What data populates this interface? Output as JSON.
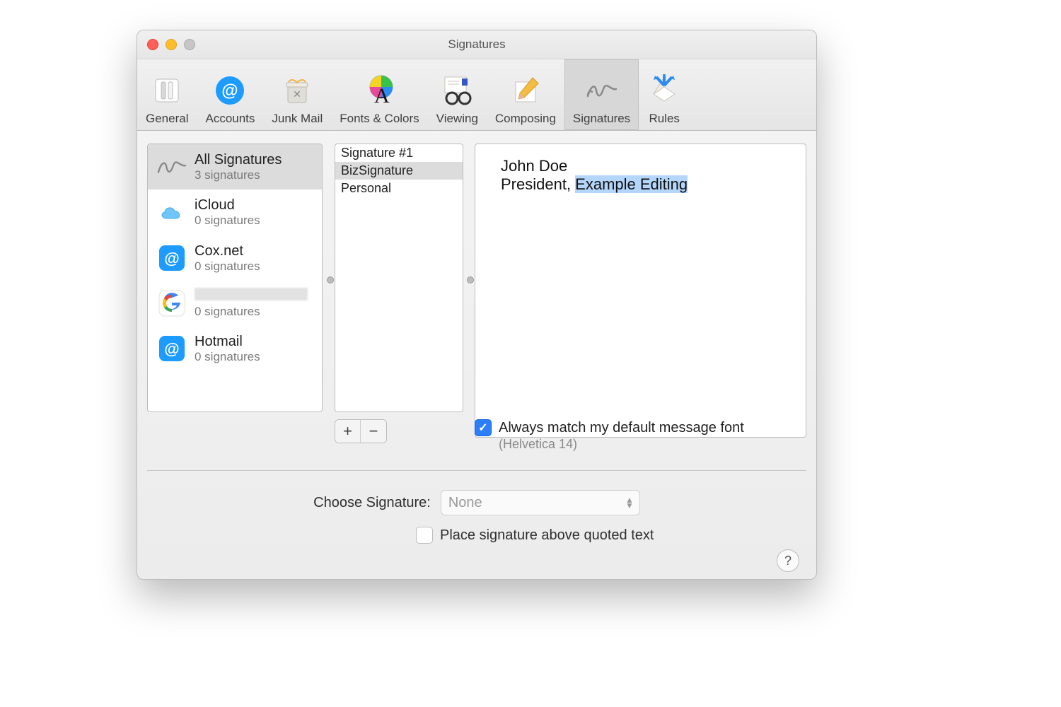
{
  "window": {
    "title": "Signatures"
  },
  "toolbar": {
    "items": [
      {
        "label": "General"
      },
      {
        "label": "Accounts"
      },
      {
        "label": "Junk Mail"
      },
      {
        "label": "Fonts & Colors"
      },
      {
        "label": "Viewing"
      },
      {
        "label": "Composing"
      },
      {
        "label": "Signatures"
      },
      {
        "label": "Rules"
      }
    ]
  },
  "accounts": [
    {
      "title": "All Signatures",
      "subtitle": "3 signatures",
      "selected": true
    },
    {
      "title": "iCloud",
      "subtitle": "0 signatures"
    },
    {
      "title": "Cox.net",
      "subtitle": "0 signatures"
    },
    {
      "title": "",
      "subtitle": "0 signatures",
      "redacted": true
    },
    {
      "title": "Hotmail",
      "subtitle": "0 signatures"
    }
  ],
  "signatures": [
    {
      "name": "Signature #1"
    },
    {
      "name": "BizSignature",
      "selected": true
    },
    {
      "name": "Personal"
    }
  ],
  "editor": {
    "line1": "John Doe",
    "line2_prefix": "President, ",
    "line2_selected": "Example Editing"
  },
  "options": {
    "always_match_label": "Always match my default message font",
    "always_match_sub": "(Helvetica 14)",
    "always_match_checked": true,
    "choose_label": "Choose Signature:",
    "choose_value": "None",
    "place_above_label": "Place signature above quoted text",
    "place_above_checked": false
  },
  "buttons": {
    "add": "+",
    "remove": "−",
    "help": "?"
  }
}
